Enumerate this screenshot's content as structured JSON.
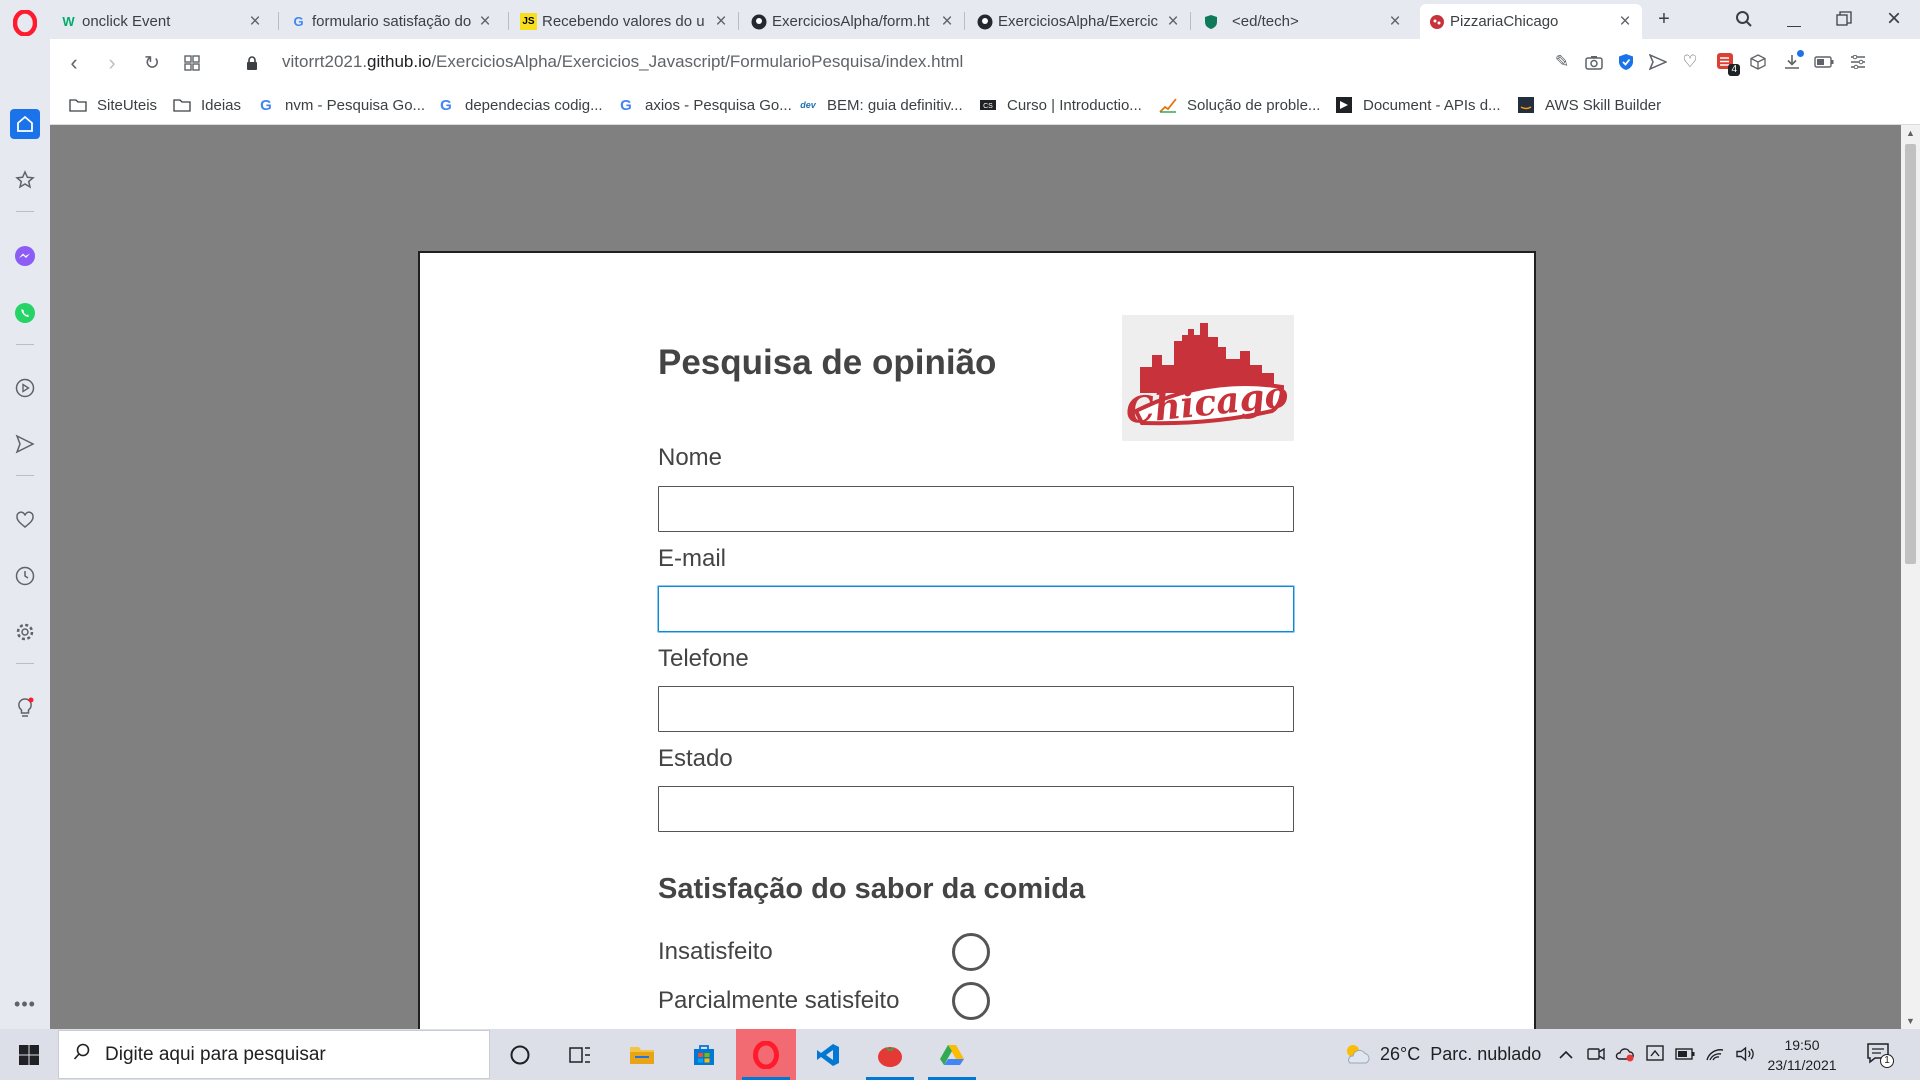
{
  "browser": {
    "tabs": [
      {
        "title": "onclick Event",
        "favicon": "w3schools-icon",
        "active": false
      },
      {
        "title": "formulario satisfação do",
        "favicon": "google-icon",
        "active": false
      },
      {
        "title": "Recebendo valores do u",
        "favicon": "js-icon",
        "active": false
      },
      {
        "title": "ExerciciosAlpha/form.ht",
        "favicon": "github-icon",
        "active": false
      },
      {
        "title": "ExerciciosAlpha/Exercic",
        "favicon": "github-icon",
        "active": false
      },
      {
        "title": "<ed/tech>",
        "favicon": "shield-icon",
        "active": false
      },
      {
        "title": "PizzariaChicago",
        "favicon": "pizza-icon",
        "active": true
      }
    ],
    "url": {
      "prefix": "vitorrt2021.",
      "host": "github.io",
      "path": "/ExerciciosAlpha/Exercicios_Javascript/FormularioPesquisa/index.html"
    },
    "extension_badge": "4",
    "bookmarks": [
      {
        "label": "SiteUteis",
        "icon": "folder-icon"
      },
      {
        "label": "Ideias",
        "icon": "folder-icon"
      },
      {
        "label": "nvm - Pesquisa Go...",
        "icon": "google-icon"
      },
      {
        "label": "dependecias codig...",
        "icon": "google-icon"
      },
      {
        "label": "axios - Pesquisa Go...",
        "icon": "google-icon"
      },
      {
        "label": "BEM: guia definitiv...",
        "icon": "bem-icon"
      },
      {
        "label": "Curso | Introductio...",
        "icon": "course-icon"
      },
      {
        "label": "Solução de proble...",
        "icon": "chart-icon"
      },
      {
        "label": "Document - APIs d...",
        "icon": "document-icon"
      },
      {
        "label": "AWS Skill Builder",
        "icon": "aws-icon"
      }
    ]
  },
  "page": {
    "title": "Pesquisa de opinião",
    "logo_text": "Chicago",
    "fields": [
      {
        "label": "Nome",
        "value": "",
        "focused": false
      },
      {
        "label": "E-mail",
        "value": "",
        "focused": true
      },
      {
        "label": "Telefone",
        "value": "",
        "focused": false
      },
      {
        "label": "Estado",
        "value": "",
        "focused": false
      }
    ],
    "section_title": "Satisfação do sabor da comida",
    "options": [
      {
        "label": "Insatisfeito",
        "checked": false
      },
      {
        "label": "Parcialmente satisfeito",
        "checked": false
      }
    ]
  },
  "taskbar": {
    "search_placeholder": "Digite aqui para pesquisar",
    "weather_temp": "26°C",
    "weather_desc": "Parc. nublado",
    "time": "19:50",
    "date": "23/11/2021",
    "notification_count": "1"
  },
  "colors": {
    "opera_red": "#ff1b2d",
    "page_background": "#808080",
    "focus_blue": "#0b8bd6",
    "logo_red": "#c8323a",
    "taskbar_accent": "#0078d4"
  }
}
